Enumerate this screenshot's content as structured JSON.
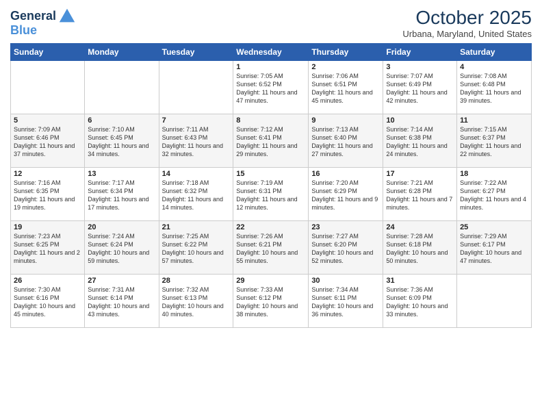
{
  "header": {
    "logo_line1": "General",
    "logo_line2": "Blue",
    "month": "October 2025",
    "location": "Urbana, Maryland, United States"
  },
  "weekdays": [
    "Sunday",
    "Monday",
    "Tuesday",
    "Wednesday",
    "Thursday",
    "Friday",
    "Saturday"
  ],
  "weeks": [
    [
      {
        "day": "",
        "info": ""
      },
      {
        "day": "",
        "info": ""
      },
      {
        "day": "",
        "info": ""
      },
      {
        "day": "1",
        "info": "Sunrise: 7:05 AM\nSunset: 6:52 PM\nDaylight: 11 hours and 47 minutes."
      },
      {
        "day": "2",
        "info": "Sunrise: 7:06 AM\nSunset: 6:51 PM\nDaylight: 11 hours and 45 minutes."
      },
      {
        "day": "3",
        "info": "Sunrise: 7:07 AM\nSunset: 6:49 PM\nDaylight: 11 hours and 42 minutes."
      },
      {
        "day": "4",
        "info": "Sunrise: 7:08 AM\nSunset: 6:48 PM\nDaylight: 11 hours and 39 minutes."
      }
    ],
    [
      {
        "day": "5",
        "info": "Sunrise: 7:09 AM\nSunset: 6:46 PM\nDaylight: 11 hours and 37 minutes."
      },
      {
        "day": "6",
        "info": "Sunrise: 7:10 AM\nSunset: 6:45 PM\nDaylight: 11 hours and 34 minutes."
      },
      {
        "day": "7",
        "info": "Sunrise: 7:11 AM\nSunset: 6:43 PM\nDaylight: 11 hours and 32 minutes."
      },
      {
        "day": "8",
        "info": "Sunrise: 7:12 AM\nSunset: 6:41 PM\nDaylight: 11 hours and 29 minutes."
      },
      {
        "day": "9",
        "info": "Sunrise: 7:13 AM\nSunset: 6:40 PM\nDaylight: 11 hours and 27 minutes."
      },
      {
        "day": "10",
        "info": "Sunrise: 7:14 AM\nSunset: 6:38 PM\nDaylight: 11 hours and 24 minutes."
      },
      {
        "day": "11",
        "info": "Sunrise: 7:15 AM\nSunset: 6:37 PM\nDaylight: 11 hours and 22 minutes."
      }
    ],
    [
      {
        "day": "12",
        "info": "Sunrise: 7:16 AM\nSunset: 6:35 PM\nDaylight: 11 hours and 19 minutes."
      },
      {
        "day": "13",
        "info": "Sunrise: 7:17 AM\nSunset: 6:34 PM\nDaylight: 11 hours and 17 minutes."
      },
      {
        "day": "14",
        "info": "Sunrise: 7:18 AM\nSunset: 6:32 PM\nDaylight: 11 hours and 14 minutes."
      },
      {
        "day": "15",
        "info": "Sunrise: 7:19 AM\nSunset: 6:31 PM\nDaylight: 11 hours and 12 minutes."
      },
      {
        "day": "16",
        "info": "Sunrise: 7:20 AM\nSunset: 6:29 PM\nDaylight: 11 hours and 9 minutes."
      },
      {
        "day": "17",
        "info": "Sunrise: 7:21 AM\nSunset: 6:28 PM\nDaylight: 11 hours and 7 minutes."
      },
      {
        "day": "18",
        "info": "Sunrise: 7:22 AM\nSunset: 6:27 PM\nDaylight: 11 hours and 4 minutes."
      }
    ],
    [
      {
        "day": "19",
        "info": "Sunrise: 7:23 AM\nSunset: 6:25 PM\nDaylight: 11 hours and 2 minutes."
      },
      {
        "day": "20",
        "info": "Sunrise: 7:24 AM\nSunset: 6:24 PM\nDaylight: 10 hours and 59 minutes."
      },
      {
        "day": "21",
        "info": "Sunrise: 7:25 AM\nSunset: 6:22 PM\nDaylight: 10 hours and 57 minutes."
      },
      {
        "day": "22",
        "info": "Sunrise: 7:26 AM\nSunset: 6:21 PM\nDaylight: 10 hours and 55 minutes."
      },
      {
        "day": "23",
        "info": "Sunrise: 7:27 AM\nSunset: 6:20 PM\nDaylight: 10 hours and 52 minutes."
      },
      {
        "day": "24",
        "info": "Sunrise: 7:28 AM\nSunset: 6:18 PM\nDaylight: 10 hours and 50 minutes."
      },
      {
        "day": "25",
        "info": "Sunrise: 7:29 AM\nSunset: 6:17 PM\nDaylight: 10 hours and 47 minutes."
      }
    ],
    [
      {
        "day": "26",
        "info": "Sunrise: 7:30 AM\nSunset: 6:16 PM\nDaylight: 10 hours and 45 minutes."
      },
      {
        "day": "27",
        "info": "Sunrise: 7:31 AM\nSunset: 6:14 PM\nDaylight: 10 hours and 43 minutes."
      },
      {
        "day": "28",
        "info": "Sunrise: 7:32 AM\nSunset: 6:13 PM\nDaylight: 10 hours and 40 minutes."
      },
      {
        "day": "29",
        "info": "Sunrise: 7:33 AM\nSunset: 6:12 PM\nDaylight: 10 hours and 38 minutes."
      },
      {
        "day": "30",
        "info": "Sunrise: 7:34 AM\nSunset: 6:11 PM\nDaylight: 10 hours and 36 minutes."
      },
      {
        "day": "31",
        "info": "Sunrise: 7:36 AM\nSunset: 6:09 PM\nDaylight: 10 hours and 33 minutes."
      },
      {
        "day": "",
        "info": ""
      }
    ]
  ]
}
